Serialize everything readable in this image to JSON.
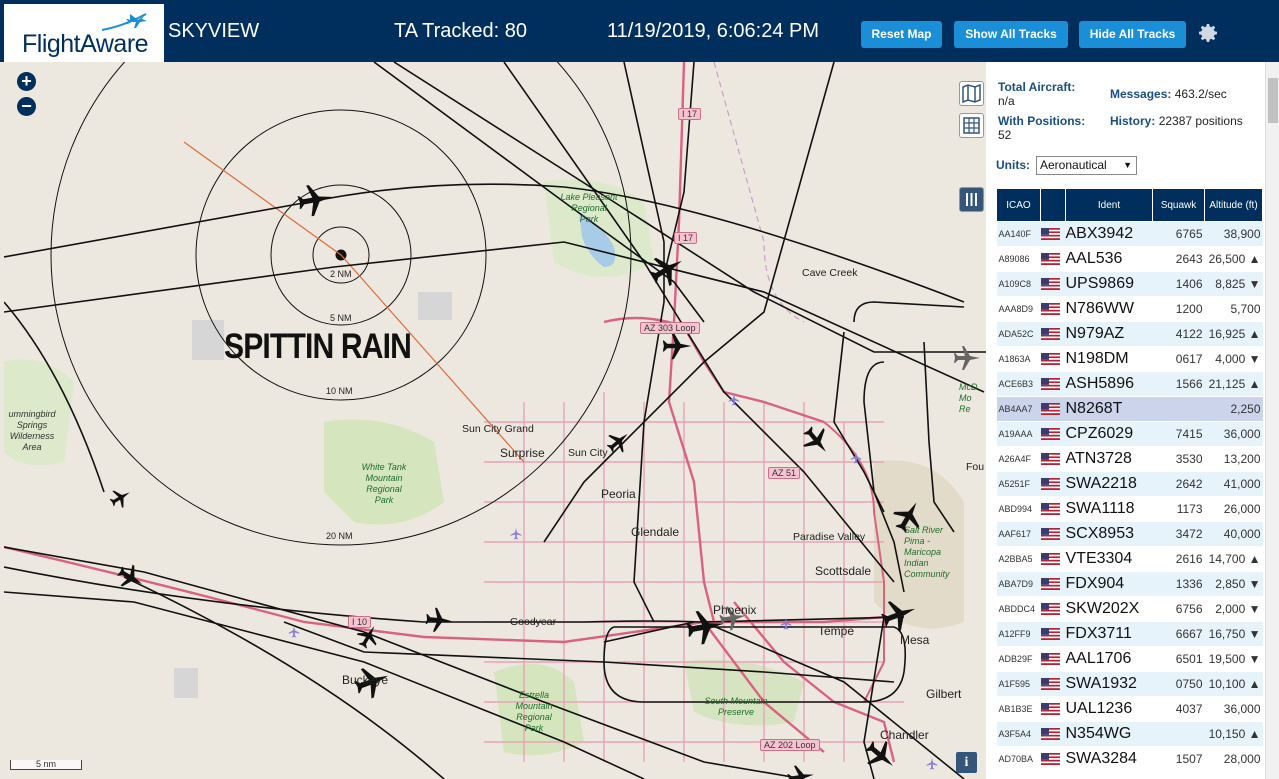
{
  "header": {
    "logo_text": "FlightAware",
    "app_title": "SKYVIEW",
    "tracked": "TA Tracked: 80",
    "datetime": "11/19/2019, 6:06:24 PM",
    "reset_map": "Reset Map",
    "show_all_tracks": "Show All Tracks",
    "hide_all_tracks": "Hide All Tracks"
  },
  "map": {
    "zoom_in": "+",
    "zoom_out": "−",
    "weather_label": "SPITTIN RAIN",
    "rings": [
      "2 NM",
      "5 NM",
      "10 NM",
      "20 NM"
    ],
    "scale": "5 nm",
    "info": "i",
    "places": {
      "lake_pleasant": "Lake Pleasant\nRegional\nPark",
      "cave_creek": "Cave Creek",
      "sun_city_grand": "Sun City Grand",
      "sun_city": "Sun City",
      "surprise": "Surprise",
      "peoria": "Peoria",
      "glendale": "Glendale",
      "white_tank": "White Tank\nMountain\nRegional\nPark",
      "hummingbird": "ummingbird\nSprings\nWilderness\nArea",
      "paradise_valley": "Paradise Valley",
      "scottsdale": "Scottsdale",
      "phoenix": "Phoenix",
      "tempe": "Tempe",
      "mesa": "Mesa",
      "gilbert": "Gilbert",
      "chandler": "Chandler",
      "goodyear": "Goodyear",
      "buckeye": "Buckeye",
      "estrella": "Estrella\nMountain\nRegional\nPark",
      "south_mountain": "South Mountain\nPreserve",
      "salt_river": "Salt River\nPima -\nMaricopa\nIndian\nCommunity",
      "mcdowell": "McD\nMo\nRe",
      "fountain": "Fou"
    },
    "roads": {
      "i17_north": "I 17",
      "i17": "I 17",
      "az303": "AZ 303 Loop",
      "az51": "AZ 51",
      "i10": "I 10",
      "az202": "AZ 202 Loop"
    }
  },
  "sidebar": {
    "total_aircraft_label": "Total Aircraft:",
    "total_aircraft_value": "n/a",
    "with_positions_label": "With Positions:",
    "with_positions_value": "52",
    "messages_label": "Messages:",
    "messages_value": "463.2/sec",
    "history_label": "History:",
    "history_value": "22387 positions",
    "units_label": "Units:",
    "units_value": "Aeronautical",
    "columns": [
      "ICAO",
      "",
      "Ident",
      "Squawk",
      "Altitude (ft)"
    ],
    "rows": [
      {
        "icao": "AA140F",
        "ident": "ABX3942",
        "squawk": "6765",
        "alt": "38,900"
      },
      {
        "icao": "A89086",
        "ident": "AAL536",
        "squawk": "2643",
        "alt": "26,500 ▲"
      },
      {
        "icao": "A109C8",
        "ident": "UPS9869",
        "squawk": "1406",
        "alt": "8,825 ▼"
      },
      {
        "icao": "AAA8D9",
        "ident": "N786WW",
        "squawk": "1200",
        "alt": "5,700"
      },
      {
        "icao": "ADA52C",
        "ident": "N979AZ",
        "squawk": "4122",
        "alt": "16,925 ▲"
      },
      {
        "icao": "A1863A",
        "ident": "N198DM",
        "squawk": "0617",
        "alt": "4,000 ▼"
      },
      {
        "icao": "ACE6B3",
        "ident": "ASH5896",
        "squawk": "1566",
        "alt": "21,125 ▲"
      },
      {
        "icao": "AB4AA7",
        "ident": "N8268T",
        "squawk": "",
        "alt": "2,250",
        "selected": true
      },
      {
        "icao": "A19AAA",
        "ident": "CPZ6029",
        "squawk": "7415",
        "alt": "36,000"
      },
      {
        "icao": "A26A4F",
        "ident": "ATN3728",
        "squawk": "3530",
        "alt": "13,200"
      },
      {
        "icao": "A5251F",
        "ident": "SWA2218",
        "squawk": "2642",
        "alt": "41,000"
      },
      {
        "icao": "ABD994",
        "ident": "SWA1118",
        "squawk": "1173",
        "alt": "26,000"
      },
      {
        "icao": "AAF617",
        "ident": "SCX8953",
        "squawk": "3472",
        "alt": "40,000"
      },
      {
        "icao": "A2BBA5",
        "ident": "VTE3304",
        "squawk": "2616",
        "alt": "14,700 ▲"
      },
      {
        "icao": "ABA7D9",
        "ident": "FDX904",
        "squawk": "1336",
        "alt": "2,850 ▼"
      },
      {
        "icao": "ABDDC4",
        "ident": "SKW202X",
        "squawk": "6756",
        "alt": "2,000 ▼"
      },
      {
        "icao": "A12FF9",
        "ident": "FDX3711",
        "squawk": "6667",
        "alt": "16,750 ▼"
      },
      {
        "icao": "ADB29F",
        "ident": "AAL1706",
        "squawk": "6501",
        "alt": "19,500 ▼"
      },
      {
        "icao": "A1F595",
        "ident": "SWA1932",
        "squawk": "0750",
        "alt": "10,100 ▲"
      },
      {
        "icao": "AB1B3E",
        "ident": "UAL1236",
        "squawk": "4037",
        "alt": "36,000"
      },
      {
        "icao": "A3F5A4",
        "ident": "N354WG",
        "squawk": "",
        "alt": "10,150 ▲"
      },
      {
        "icao": "AD70BA",
        "ident": "SWA3284",
        "squawk": "1507",
        "alt": "28,000"
      }
    ]
  }
}
